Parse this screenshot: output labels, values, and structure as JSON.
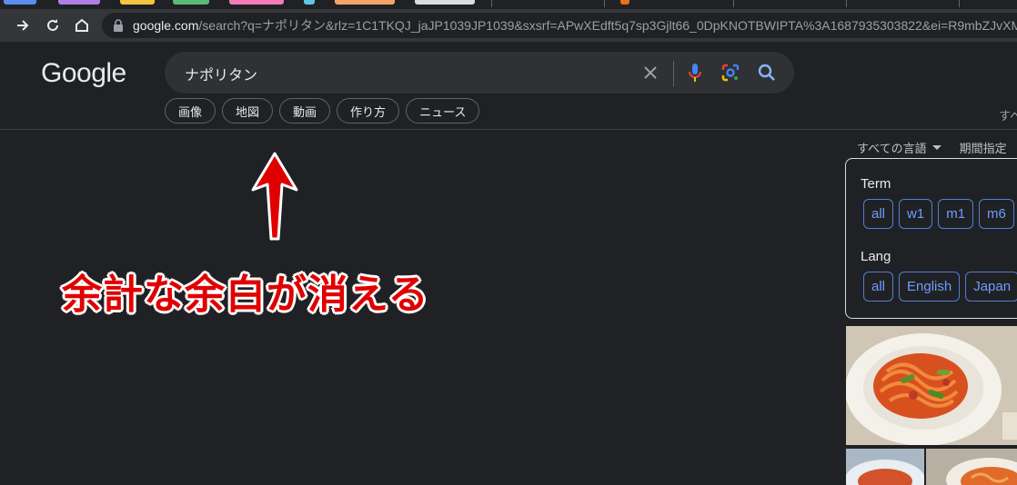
{
  "browser": {
    "url_host": "google.com",
    "url_rest": "/search?q=ナポリタン&rlz=1C1TKQJ_jaJP1039JP1039&sxsrf=APwXEdft5q7sp3Gjlt66_0DpKNOTBWIPTA%3A1687935303822&ei=R9mbZJvXMY-U-Ab",
    "icons": [
      "forward-icon",
      "reload-icon",
      "home-icon",
      "lock-icon"
    ]
  },
  "google": {
    "logo_text": "Google",
    "search_value": "ナポリタン",
    "chips": [
      "画像",
      "地図",
      "動画",
      "作り方",
      "ニュース"
    ],
    "header_right": "すべ",
    "tools": {
      "lang": "すべての言語",
      "period": "期間指定"
    }
  },
  "panel": {
    "term_label": "Term",
    "term_buttons": [
      "all",
      "w1",
      "m1",
      "m6"
    ],
    "lang_label": "Lang",
    "lang_buttons": [
      "all",
      "English",
      "Japan"
    ]
  },
  "annotation": {
    "text": "余計な余白が消える",
    "color": "#e00000"
  },
  "colors": {
    "background": "#202124",
    "toolbar": "#35363a",
    "link_blue": "#6d9eff"
  }
}
